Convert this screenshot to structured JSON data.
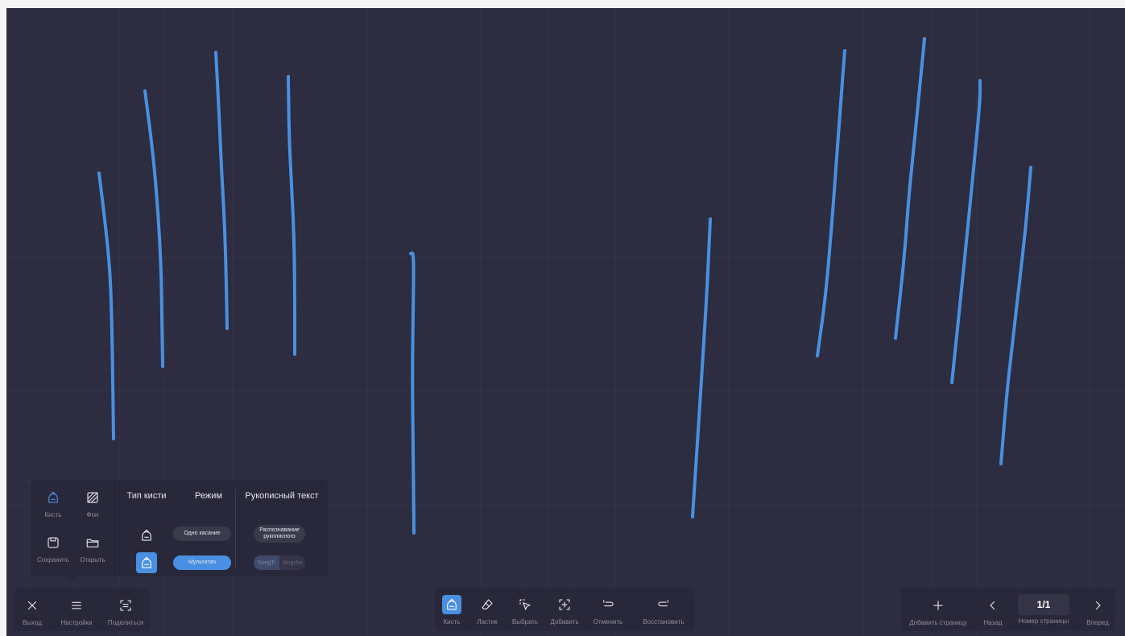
{
  "colors": {
    "canvas_bg": "#2d2c40",
    "panel_bg": "#29283a",
    "accent": "#4a90e2",
    "stroke": "#4a90e2",
    "muted_label": "#8d8c9c"
  },
  "left_toolbar": {
    "exit": {
      "label": "Выход",
      "icon": "close-icon"
    },
    "settings": {
      "label": "Настройки",
      "icon": "menu-icon"
    },
    "share": {
      "label": "Поделиться",
      "icon": "qr-scan-icon"
    }
  },
  "settings_popup": {
    "brush": {
      "label": "Кисть",
      "icon": "brush-icon"
    },
    "background": {
      "label": "Фон",
      "icon": "background-icon"
    },
    "save": {
      "label": "Сохранить",
      "icon": "save-icon"
    },
    "open": {
      "label": "Открыть",
      "icon": "folder-icon"
    },
    "brush_type_title": "Тип кисти",
    "mode_title": "Режим",
    "handwriting_title": "Рукописный текст",
    "mode_single": "Одно касание",
    "mode_multi": "Мультитач",
    "recognition": "Распознавание рукописного",
    "fonts": [
      "SongTi",
      "Xingshu"
    ]
  },
  "center_toolbar": [
    {
      "id": "brush",
      "label": "Кисть",
      "icon": "brush-icon",
      "active": true
    },
    {
      "id": "eraser",
      "label": "Ластик",
      "icon": "eraser-icon",
      "active": false
    },
    {
      "id": "select",
      "label": "Выбрать",
      "icon": "select-icon",
      "active": false
    },
    {
      "id": "add",
      "label": "Добавить",
      "icon": "add-frame-icon",
      "active": false
    },
    {
      "id": "undo",
      "label": "Отменить",
      "icon": "undo-icon",
      "active": false
    },
    {
      "id": "redo",
      "label": "Восстановить",
      "icon": "redo-icon",
      "active": false
    }
  ],
  "right_toolbar": {
    "add_page": {
      "label": "Добавить страницу",
      "icon": "plus-icon"
    },
    "back": {
      "label": "Назад",
      "icon": "chevron-left-icon"
    },
    "page_number": {
      "label": "Номер страницы",
      "value": "1/1"
    },
    "forward": {
      "label": "Вперед",
      "icon": "chevron-right-icon"
    }
  }
}
